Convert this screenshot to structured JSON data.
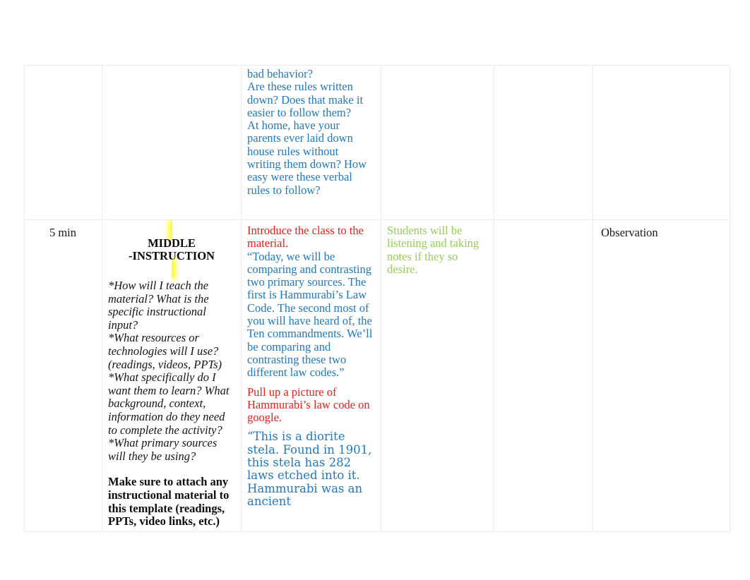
{
  "document": {
    "type": "lesson-plan-table",
    "colors": {
      "blue": "#1f78c1",
      "red": "#ef1b17",
      "green": "#96cc5a",
      "highlight_yellow": "#ffff00",
      "border": "#ececed",
      "text_black": "#141414"
    }
  },
  "table": {
    "columns": [
      "time",
      "phase",
      "teacher-actions",
      "student-actions",
      "materials",
      "assessment"
    ],
    "rows": [
      {
        "name": "continuation-row",
        "time": "",
        "phase": "",
        "teacher_continued": [
          "bad behavior?",
          "Are these rules written down? Does that make it easier to follow them?",
          "At home, have your parents ever laid down house rules without writing them down? How easy were these verbal rules to follow?"
        ],
        "student": "",
        "materials": "",
        "assessment": ""
      },
      {
        "name": "middle-instruction-row",
        "time": "5 min",
        "phase_title_line1": "MIDDLE",
        "phase_title_line2": "-INSTRUCTION",
        "phase_prompts": [
          "*How will I teach the material? What is the specific instructional input?",
          "*What resources or technologies will I use? (readings, videos, PPTs)",
          "*What specifically do I want them to learn? What background, context, information do they need to complete the activity?",
          "*What primary sources will they be using?"
        ],
        "phase_note": "Make sure to attach any instructional material to this template (readings, PPTs, video links, etc.)",
        "teacher_heading_1": "Introduce the class to the material.",
        "teacher_quote_1": "“Today, we will be comparing and contrasting two primary sources. The first is Hammurabi’s Law Code. The second most of you will have heard of, the Ten commandments. We’ll be comparing and contrasting these two different law codes.”",
        "teacher_heading_2": "Pull up a picture of Hammurabi’s law code on google.",
        "teacher_quote_2": "“This is a diorite stela. Found in 1901, this stela has 282 laws etched into it. Hammurabi was an ancient",
        "student": "Students will be listening and taking notes if they so desire.",
        "materials": "",
        "assessment": "Observation"
      }
    ]
  }
}
